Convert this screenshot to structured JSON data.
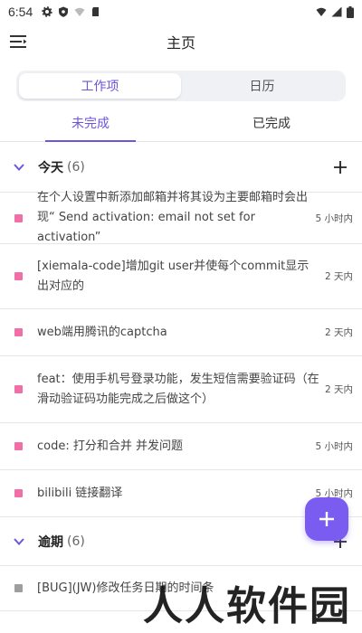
{
  "status_bar": {
    "time": "6:54"
  },
  "app_bar": {
    "title": "主页"
  },
  "segmented": {
    "items": [
      {
        "label": "工作项"
      },
      {
        "label": "日历"
      }
    ]
  },
  "subtabs": {
    "items": [
      {
        "label": "未完成"
      },
      {
        "label": "已完成"
      }
    ]
  },
  "sections": [
    {
      "title": "今天",
      "count": "(6)",
      "tasks": [
        {
          "text": "在个人设置中新添加邮箱并将其设为主要邮箱时会出现“ Send activation: email not set for activation”",
          "due": "5 小时内",
          "color": "#f06fa6"
        },
        {
          "text": "[xiemala-code]增加git user并使每个commit显示出对应的",
          "due": "2 天内",
          "color": "#f06fa6"
        },
        {
          "text": "web端用腾讯的captcha",
          "due": "2 天内",
          "color": "#f06fa6"
        },
        {
          "text": "feat：使用手机号登录功能，发生短信需要验证码（在滑动验证码功能完成之后做这个）",
          "due": "2 天内",
          "color": "#f06fa6"
        },
        {
          "text": "code: 打分和合并 并发问题",
          "due": "5 小时内",
          "color": "#f06fa6"
        },
        {
          "text": "bilibili 链接翻译",
          "due": "5 小时内",
          "color": "#f06fa6"
        }
      ]
    },
    {
      "title": "逾期",
      "count": "(6)",
      "tasks": [
        {
          "text": "[BUG](JW)修改任务日期的时间条",
          "due": "",
          "color": "#9e9e9e"
        }
      ]
    }
  ],
  "watermark": "人人软件园",
  "colors": {
    "accent": "#6e55d9",
    "fab": "#7b5cf0",
    "today_dot": "#f06fa6",
    "overdue_dot": "#9e9e9e"
  }
}
